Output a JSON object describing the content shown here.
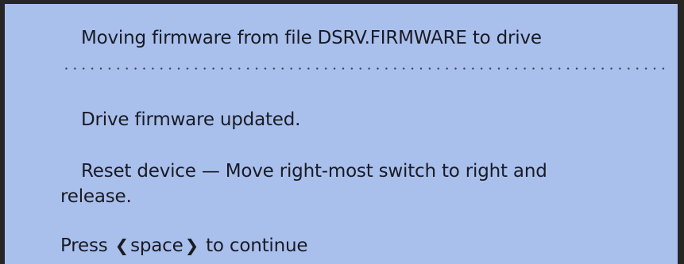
{
  "dialog": {
    "title": "Moving firmware from file DSRV.FIRMWARE to drive",
    "status": "Drive firmware updated.",
    "instruction_line1": "Reset device — Move right-most switch to right and",
    "instruction_line2": "release.",
    "prompt": {
      "prefix": "Press",
      "open_bracket": "❮",
      "key": "space",
      "close_bracket": "❯",
      "suffix": "to continue"
    }
  }
}
